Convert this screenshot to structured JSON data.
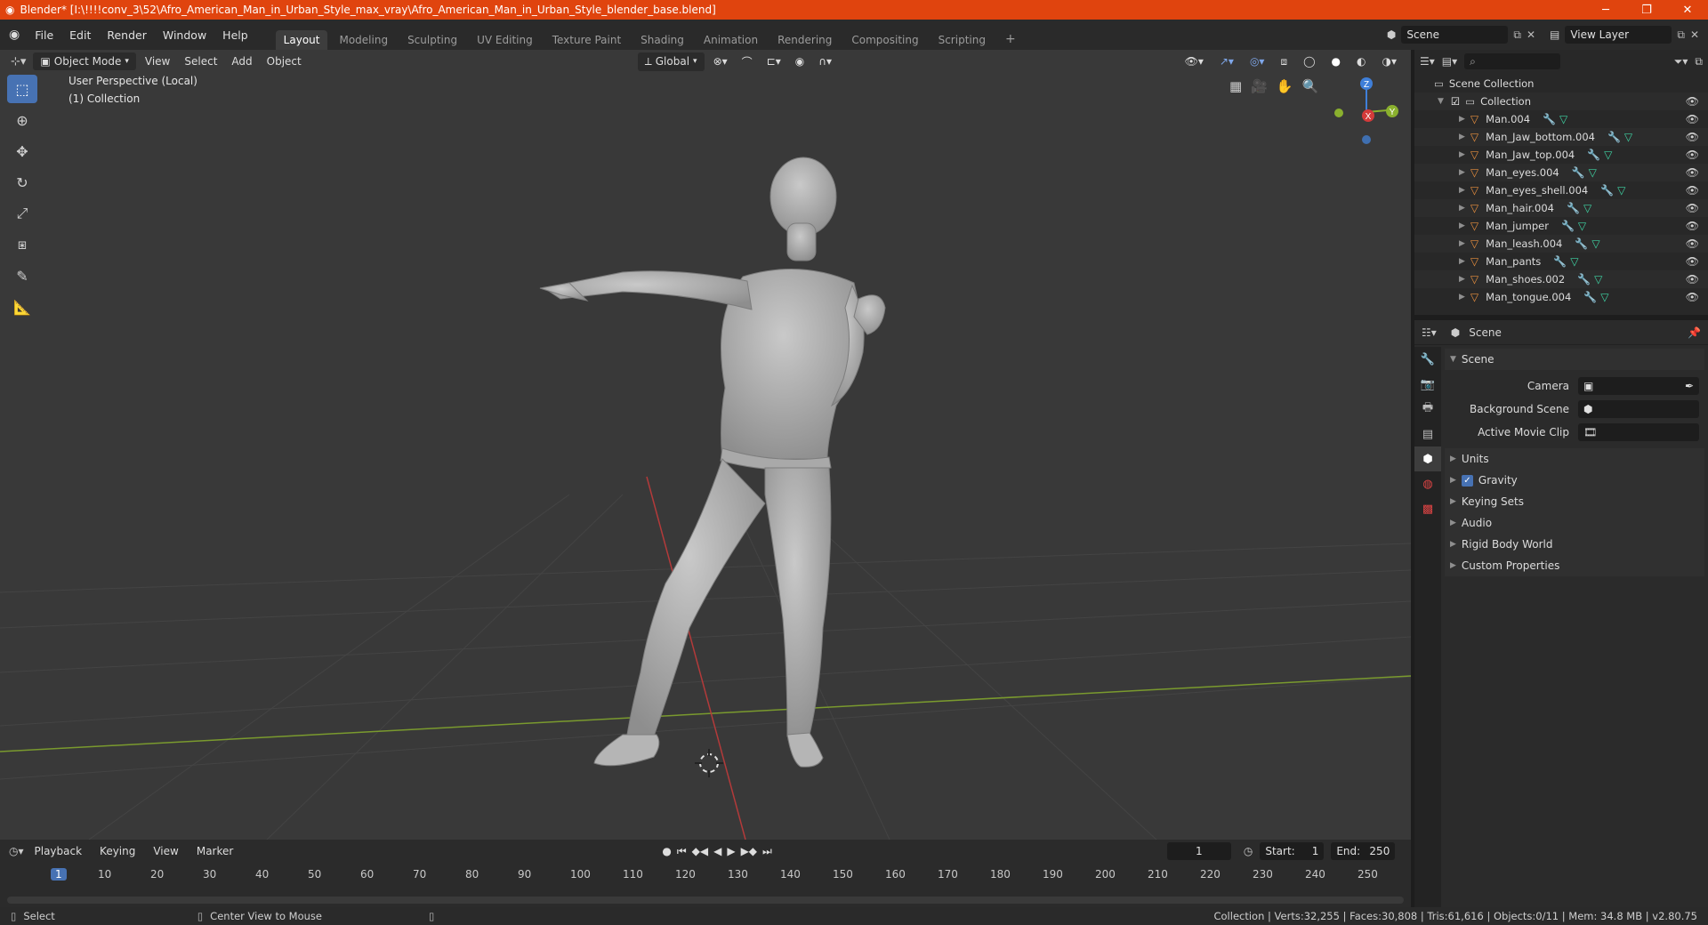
{
  "window": {
    "title": "Blender* [I:\\!!!!conv_3\\52\\Afro_American_Man_in_Urban_Style_max_vray\\Afro_American_Man_in_Urban_Style_blender_base.blend]",
    "minimize": "─",
    "maximize": "❐",
    "close": "✕"
  },
  "menu": [
    "File",
    "Edit",
    "Render",
    "Window",
    "Help"
  ],
  "workspaces": [
    "Layout",
    "Modeling",
    "Sculpting",
    "UV Editing",
    "Texture Paint",
    "Shading",
    "Animation",
    "Rendering",
    "Compositing",
    "Scripting"
  ],
  "workspace_add": "+",
  "scene_field": "Scene",
  "view_layer_field": "View Layer",
  "viewport": {
    "mode": "Object Mode",
    "menus": [
      "View",
      "Select",
      "Add",
      "Object"
    ],
    "orientation": "Global",
    "info_line1": "User Perspective (Local)",
    "info_line2": "(1) Collection",
    "gizmo_z": "Z",
    "gizmo_x": "X",
    "gizmo_y": "Y"
  },
  "outliner": {
    "root": "Scene Collection",
    "collection": "Collection",
    "items": [
      "Man.004",
      "Man_Jaw_bottom.004",
      "Man_Jaw_top.004",
      "Man_eyes.004",
      "Man_eyes_shell.004",
      "Man_hair.004",
      "Man_jumper",
      "Man_leash.004",
      "Man_pants",
      "Man_shoes.002",
      "Man_tongue.004"
    ]
  },
  "properties": {
    "header": "Scene",
    "panel_title": "Scene",
    "camera_label": "Camera",
    "background_scene_label": "Background Scene",
    "active_movie_clip_label": "Active Movie Clip",
    "sections": [
      "Units",
      "Gravity",
      "Keying Sets",
      "Audio",
      "Rigid Body World",
      "Custom Properties"
    ],
    "gravity_checked": true
  },
  "timeline": {
    "menus": [
      "Playback",
      "Keying",
      "View",
      "Marker"
    ],
    "current_frame": "1",
    "start_label": "Start:",
    "start_value": "1",
    "end_label": "End:",
    "end_value": "250",
    "ruler": [
      "1",
      "10",
      "20",
      "30",
      "40",
      "50",
      "60",
      "70",
      "80",
      "90",
      "100",
      "110",
      "120",
      "130",
      "140",
      "150",
      "160",
      "170",
      "180",
      "190",
      "200",
      "210",
      "220",
      "230",
      "240",
      "250"
    ]
  },
  "status": {
    "select": "Select",
    "center_view": "Center View to Mouse",
    "stats": "Collection | Verts:32,255 | Faces:30,808 | Tris:61,616 | Objects:0/11 | Mem: 34.8 MB | v2.80.75"
  },
  "colors": {
    "title_bar": "#e0440e",
    "accent": "#4772b3",
    "x_axis": "#d33a3a",
    "y_axis": "#8ab02e",
    "z_axis": "#3f7fd9"
  }
}
